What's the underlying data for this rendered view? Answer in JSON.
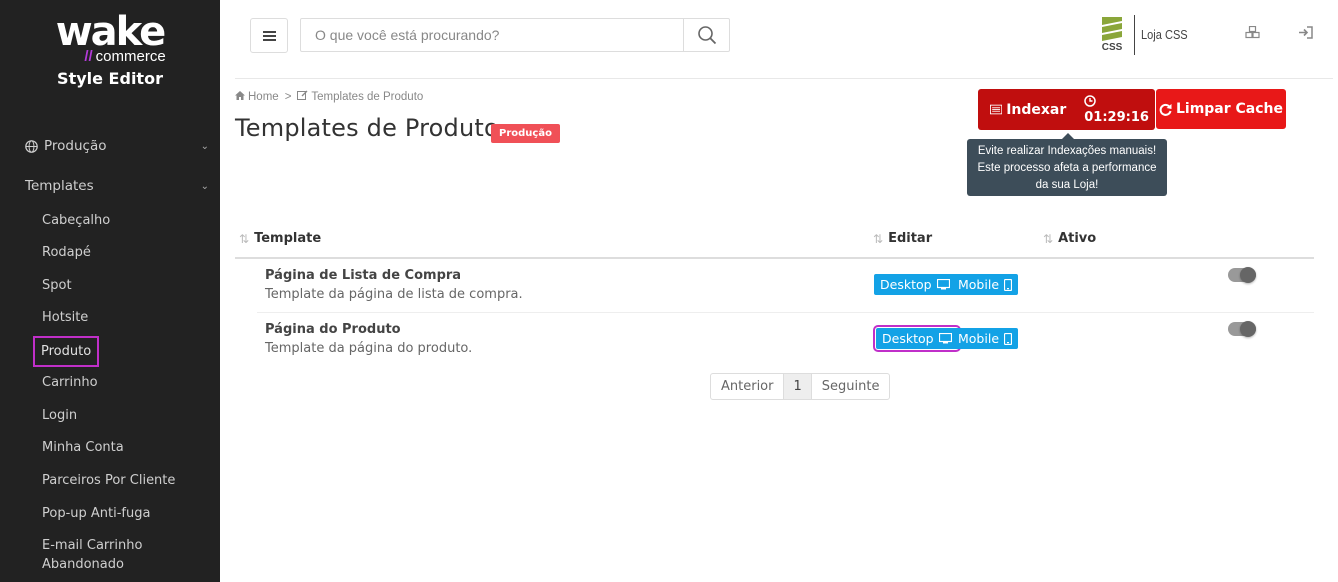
{
  "sidebar": {
    "logo": {
      "brand": "wake",
      "sub": "commerce",
      "title": "Style Editor"
    },
    "groups": [
      {
        "label": "Produção"
      },
      {
        "label": "Templates"
      }
    ],
    "items": [
      {
        "label": "Cabeçalho"
      },
      {
        "label": "Rodapé"
      },
      {
        "label": "Spot"
      },
      {
        "label": "Hotsite"
      },
      {
        "label": "Produto"
      },
      {
        "label": "Carrinho"
      },
      {
        "label": "Login"
      },
      {
        "label": "Minha Conta"
      },
      {
        "label": "Parceiros Por Cliente"
      },
      {
        "label": "Pop-up Anti-fuga"
      },
      {
        "label": "E-mail Carrinho Abandonado"
      }
    ],
    "active_item": "Produto"
  },
  "header": {
    "search_placeholder": "O que você está procurando?",
    "brand_logo_text": "CSS",
    "store_name": "Loja CSS"
  },
  "breadcrumb": {
    "home": "Home",
    "separator": ">",
    "current": "Templates de Produto"
  },
  "page": {
    "title": "Templates de Produto",
    "env_badge": "Produção"
  },
  "actions": {
    "index_label": "Indexar",
    "index_timer": "01:29:16",
    "cache_label": "Limpar Cache",
    "tooltip": "Evite realizar Indexações manuais! Este processo afeta a performance da sua Loja!"
  },
  "table": {
    "columns": [
      "Template",
      "Editar",
      "Ativo"
    ],
    "rows": [
      {
        "title": "Página de Lista de Compra",
        "description": "Template da página de lista de compra.",
        "desktop": "Desktop",
        "mobile": "Mobile",
        "active": true
      },
      {
        "title": "Página do Produto",
        "description": "Template da página do produto.",
        "desktop": "Desktop",
        "mobile": "Mobile",
        "active": true
      }
    ]
  },
  "pagination": {
    "prev": "Anterior",
    "page": "1",
    "next": "Seguinte"
  },
  "colors": {
    "sidebar_bg": "#222222",
    "primary": "#13a2e6",
    "danger": "#e81818",
    "highlight": "#c02fc9"
  }
}
